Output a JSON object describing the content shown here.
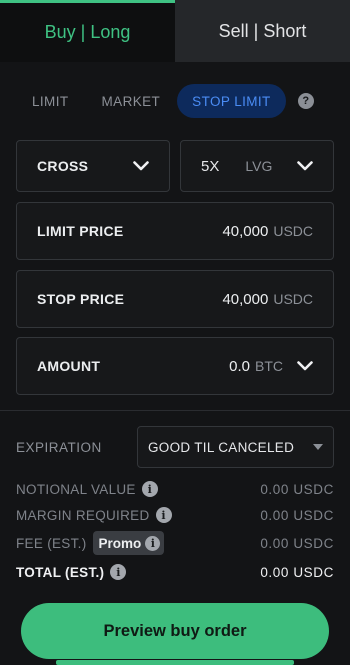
{
  "side_tabs": {
    "buy": "Buy | Long",
    "sell": "Sell | Short"
  },
  "order_types": {
    "limit": "LIMIT",
    "market": "MARKET",
    "stop_limit": "STOP LIMIT",
    "active": "STOP LIMIT",
    "help_glyph": "?"
  },
  "margin_mode": {
    "value": "CROSS"
  },
  "leverage": {
    "value": "5X",
    "unit": "LVG"
  },
  "limit_price": {
    "label": "LIMIT PRICE",
    "value": "40,000",
    "currency": "USDC"
  },
  "stop_price": {
    "label": "STOP PRICE",
    "value": "40,000",
    "currency": "USDC"
  },
  "amount": {
    "label": "AMOUNT",
    "value": "0.0",
    "currency": "BTC"
  },
  "expiration": {
    "label": "EXPIRATION",
    "value": "GOOD TIL CANCELED"
  },
  "summary": {
    "notional_value": {
      "label": "NOTIONAL VALUE",
      "value": "0.00 USDC"
    },
    "margin_required": {
      "label": "MARGIN REQUIRED",
      "value": "0.00 USDC"
    },
    "fee": {
      "label": "FEE (EST.)",
      "badge": "Promo",
      "value": "0.00 USDC"
    },
    "total": {
      "label": "TOTAL (EST.)",
      "value": "0.00 USDC"
    }
  },
  "info_glyph": "i",
  "preview_button": "Preview buy order",
  "colors": {
    "accent_green": "#3dbd7d",
    "active_tab_bg": "#0d2a5c",
    "active_tab_text": "#4a8cf4",
    "background": "#131416"
  }
}
